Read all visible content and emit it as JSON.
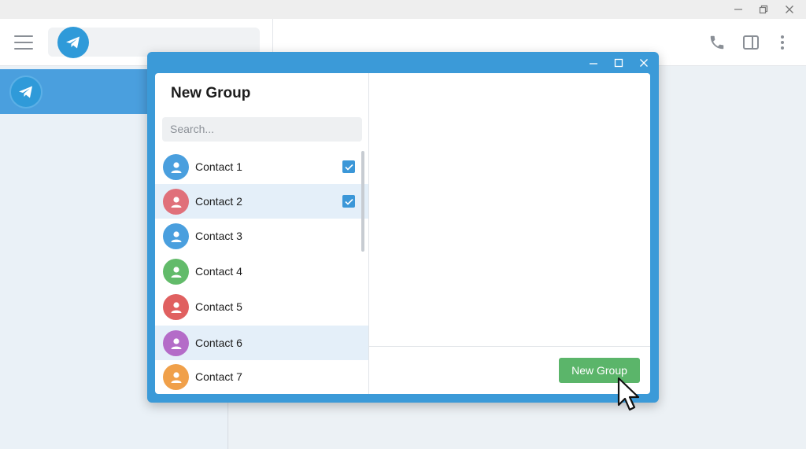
{
  "window": {
    "controls": {
      "minimize_icon": "minimize-icon",
      "restore_icon": "restore-icon",
      "close_icon": "close-icon"
    }
  },
  "header": {
    "menu_icon": "hamburger-icon",
    "logo_icon": "telegram-logo-icon",
    "actions": [
      "phone-icon",
      "sidebar-toggle-icon",
      "more-vertical-icon"
    ]
  },
  "dialog": {
    "title": "New Group",
    "search": {
      "placeholder": "Search...",
      "value": ""
    },
    "contacts": [
      {
        "name": "Contact 1",
        "avatar_color": "#4a9fde",
        "checked": true,
        "highlighted": false
      },
      {
        "name": "Contact 2",
        "avatar_color": "#e0707a",
        "checked": true,
        "highlighted": true
      },
      {
        "name": "Contact 3",
        "avatar_color": "#4a9fde",
        "checked": false,
        "highlighted": false
      },
      {
        "name": "Contact 4",
        "avatar_color": "#62bb6a",
        "checked": false,
        "highlighted": false
      },
      {
        "name": "Contact 5",
        "avatar_color": "#e06060",
        "checked": false,
        "highlighted": false
      },
      {
        "name": "Contact 6",
        "avatar_color": "#b46cc8",
        "checked": false,
        "highlighted": true
      },
      {
        "name": "Contact 7",
        "avatar_color": "#f0a04a",
        "checked": false,
        "highlighted": false
      }
    ],
    "create_button_label": "New Group"
  },
  "colors": {
    "accent": "#3b9ad8",
    "confirm_button": "#5bb56a",
    "selected_row": "#e4eff9"
  }
}
